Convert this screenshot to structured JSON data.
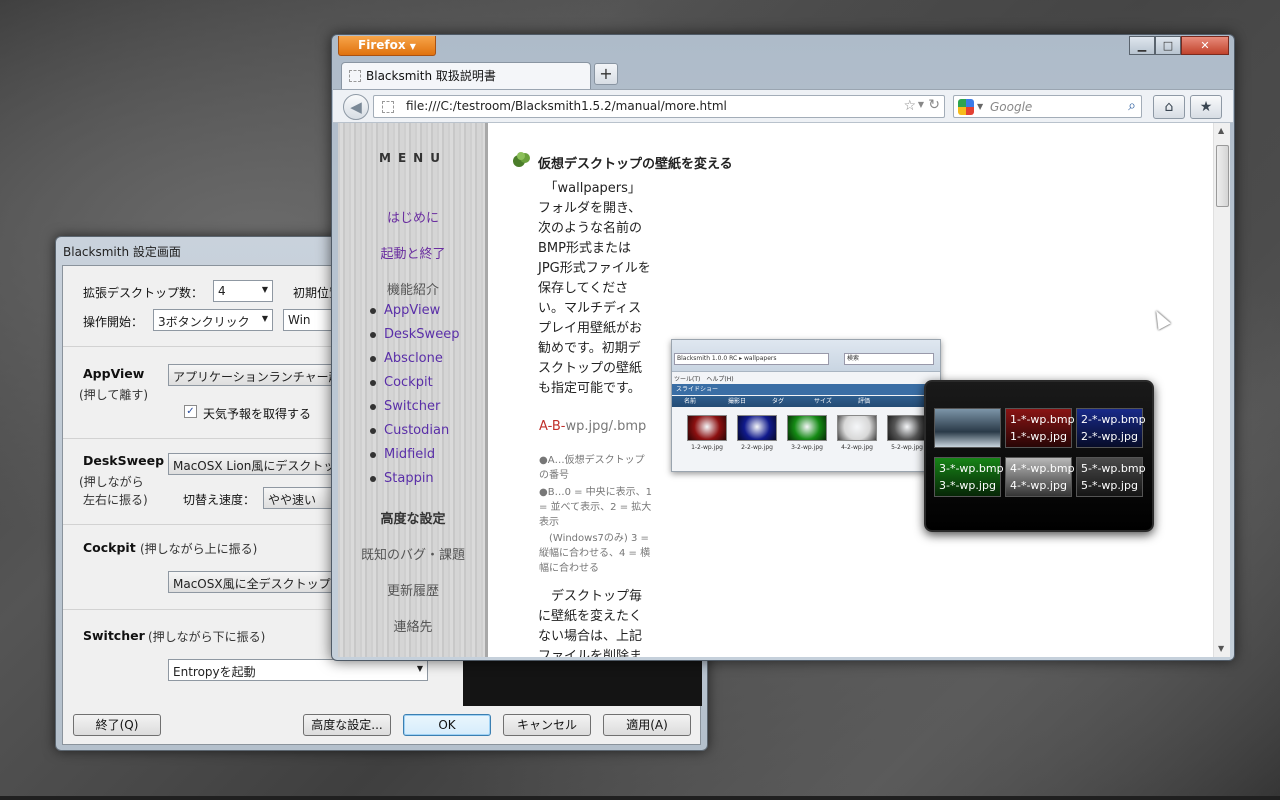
{
  "settings": {
    "title": "Blacksmith 設定画面",
    "desktops_label": "拡張デスクトップ数：",
    "desktops_value": "4",
    "initial_label": "初期位置",
    "op_start_label": "操作開始：",
    "op_start_value": "3ボタンクリック",
    "win_value": "Win",
    "appview": {
      "name": "AppView",
      "hint": "(押して離す)",
      "value": "アプリケーションランチャー起",
      "weather_label": "天気予報を取得する"
    },
    "desksweep": {
      "name": "DeskSweep",
      "hint1": "(押しながら",
      "hint2": "左右に振る)",
      "value": "MacOSX Lion風にデスクトッ",
      "speed_label": "切替え速度：",
      "speed_value": "やや速い"
    },
    "cockpit": {
      "name": "Cockpit",
      "hint": "(押しながら上に振る)",
      "value": "MacOSX風に全デスクトップを"
    },
    "switcher": {
      "name": "Switcher",
      "hint": "(押しながら下に振る)",
      "value": "Entropyを起動"
    },
    "buttons": {
      "quit": "終了(Q)",
      "advanced": "高度な設定...",
      "ok": "OK",
      "cancel": "キャンセル",
      "apply": "適用(A)"
    }
  },
  "firefox": {
    "menu_label": "Firefox",
    "tab_title": "Blacksmith 取扱説明書",
    "url": "file:///C:/testroom/Blacksmith1.5.2/manual/more.html",
    "search_placeholder": "Google",
    "sidebar": {
      "menu_title": "MENU",
      "items": [
        {
          "label": "はじめに"
        },
        {
          "label": "起動と終了"
        },
        {
          "label": "機能紹介"
        },
        {
          "label": "高度な設定"
        },
        {
          "label": "既知のバグ・課題"
        },
        {
          "label": "更新履歴"
        },
        {
          "label": "連絡先"
        }
      ],
      "features": [
        "AppView",
        "DeskSweep",
        "Absclone",
        "Cockpit",
        "Switcher",
        "Custodian",
        "Midfield",
        "Stappin"
      ]
    },
    "article": {
      "heading": "仮想デスクトップの壁紙を変える",
      "lines": [
        "　「wallpapers」",
        "フォルダを開き、",
        "次のような名前の",
        "BMP形式または",
        "JPG形式ファイルを",
        "保存してくださ",
        "い。マルチディス",
        "プレイ用壁紙がお",
        "勧めです。初期デ",
        "スクトップの壁紙",
        "も指定可能です。"
      ],
      "filename_red": "A-B-",
      "filename_rest": "wp.jpg/.bmp",
      "notes": [
        "●A…仮想デスクトップの番号",
        "●B…0 = 中央に表示、1 = 並べて表示、2 = 拡大表示",
        "　(Windows7のみ) 3 = 縦幅に合わせる、4 = 横幅に合わせる"
      ],
      "lines2": [
        "　デスクトップ毎",
        "に壁紙を変えたく",
        "ない場合は、上記",
        "ファイルを削除ま"
      ]
    },
    "explorer_shot": {
      "title": "Blacksmith 1.0.0 RC ▸ wallpapers",
      "search": "検索",
      "toolbar": "ツール(T)　ヘルプ(H)",
      "slideshow": "スライドショー",
      "cols": [
        "名前",
        "撮影日",
        "タグ",
        "サイズ",
        "評価"
      ],
      "files": [
        "1-2-wp.jpg",
        "2-2-wp.jpg",
        "3-2-wp.jpg",
        "4-2-wp.jpg",
        "5-2-wp.jpg"
      ],
      "colors": [
        "#8c1010",
        "#101a8c",
        "#148a14",
        "#d8d8d8",
        "#555555"
      ]
    },
    "grid_shot": {
      "cells": [
        {
          "a": "",
          "b": ""
        },
        {
          "a": "1-*-wp.bmp",
          "b": "1-*-wp.jpg"
        },
        {
          "a": "2-*-wp.bmp",
          "b": "2-*-wp.jpg"
        },
        {
          "a": "3-*-wp.bmp",
          "b": "3-*-wp.jpg"
        },
        {
          "a": "4-*-wp.bmp",
          "b": "4-*-wp.jpg"
        },
        {
          "a": "5-*-wp.bmp",
          "b": "5-*-wp.jpg"
        }
      ],
      "colors": [
        "#3b5a72",
        "#8a1414",
        "#182a8a",
        "#178417",
        "#b8b8b8",
        "#4a4a4a"
      ]
    }
  }
}
